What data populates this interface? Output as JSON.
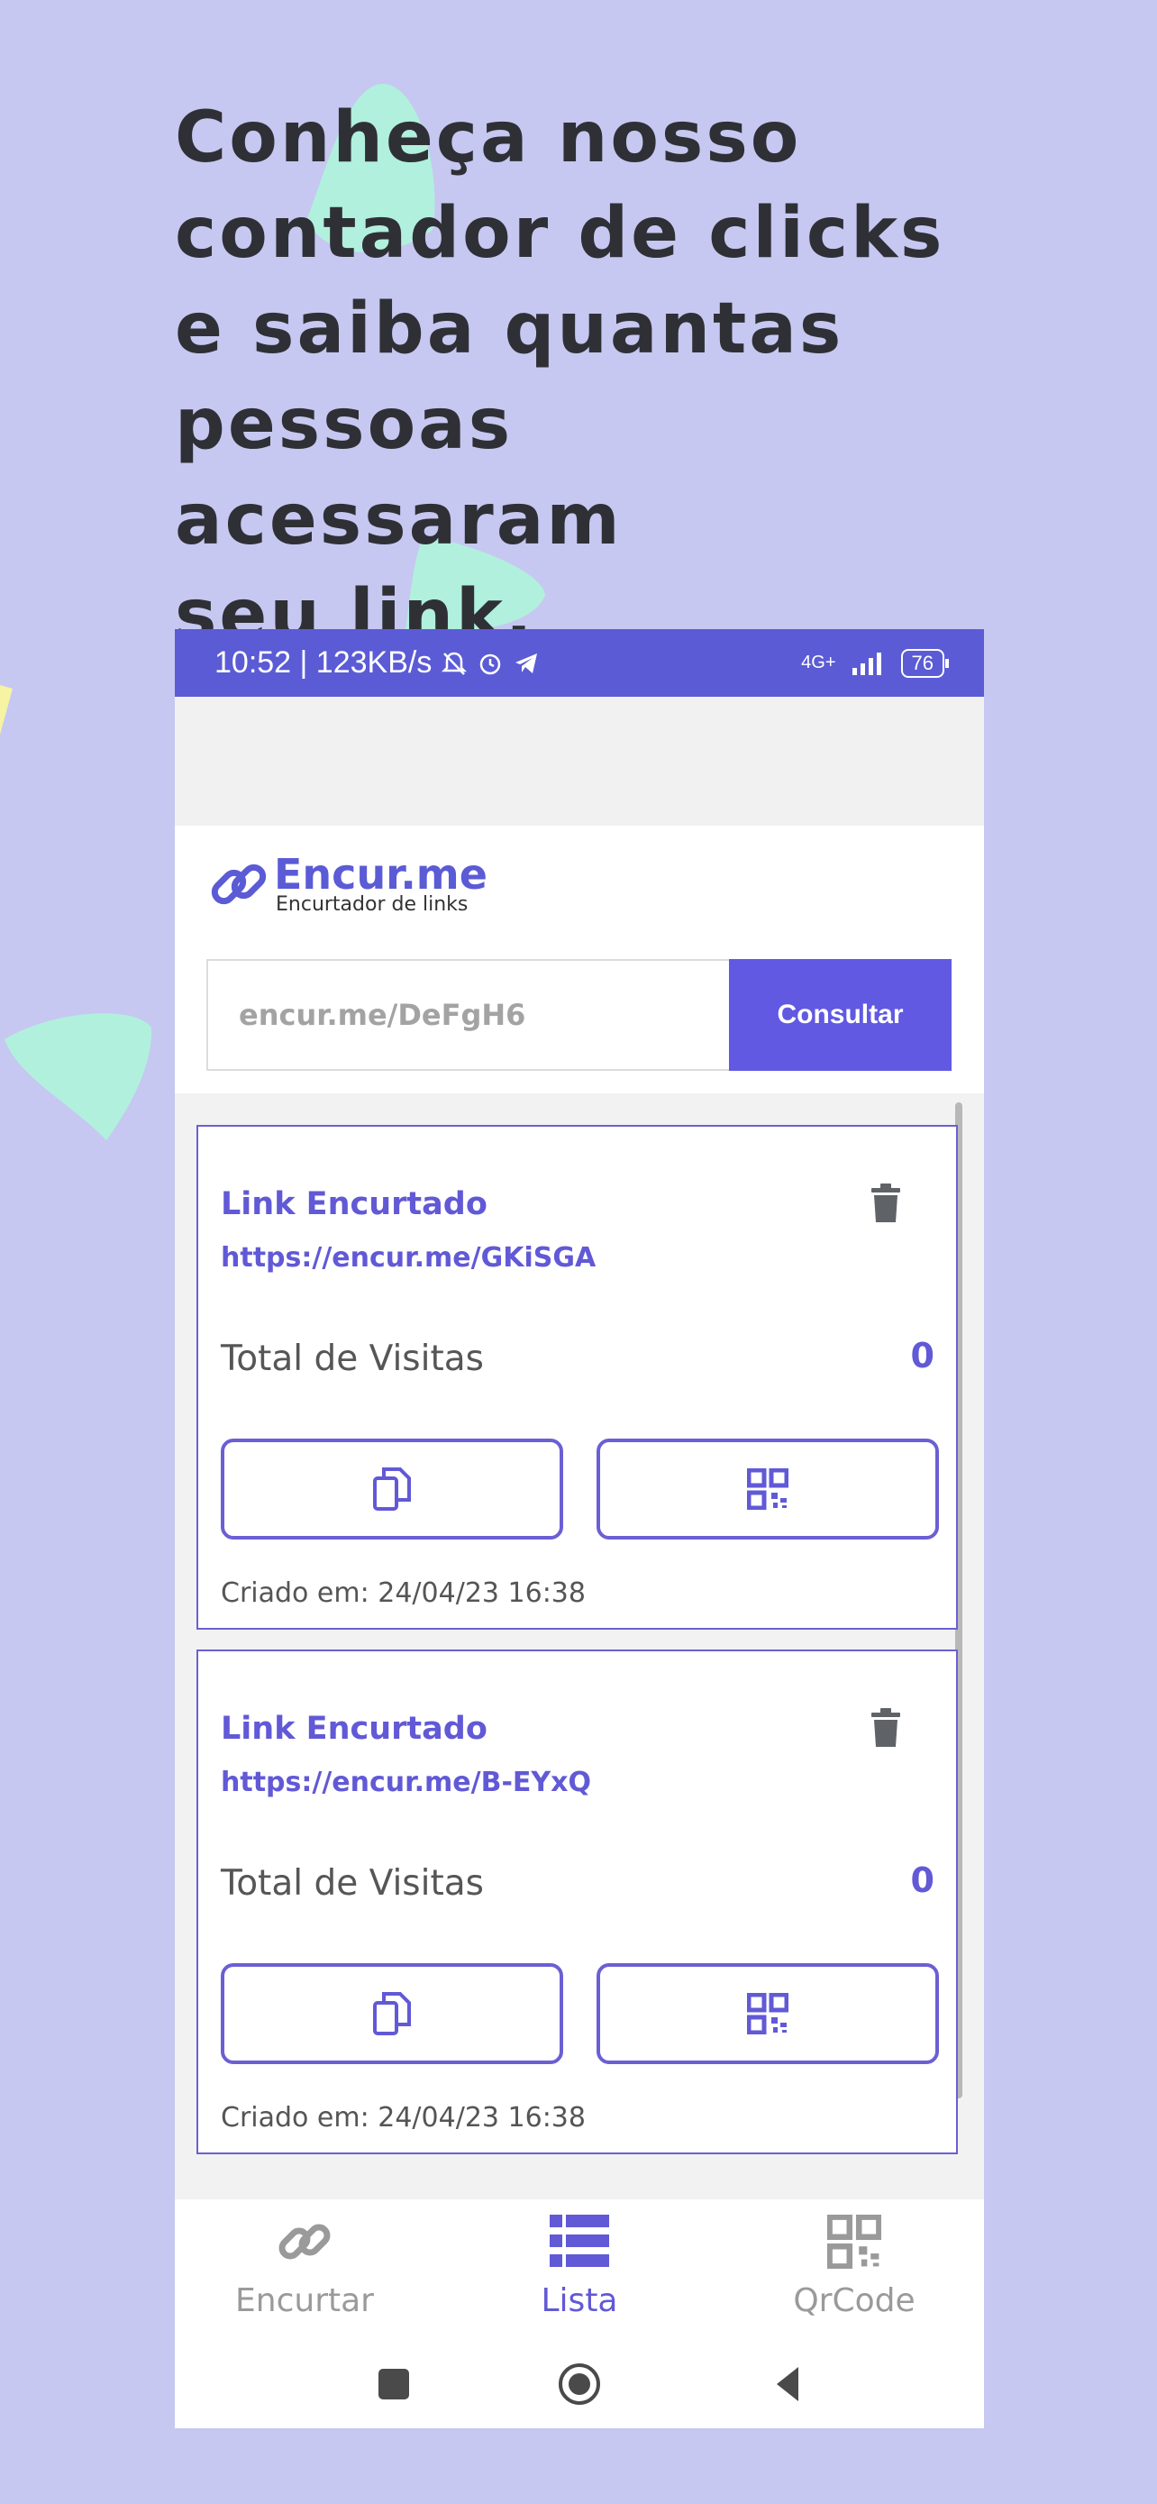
{
  "headline": {
    "line1": "Conheça nosso",
    "line2": "contador de clicks",
    "line3": "e saiba quantas",
    "line4": "pessoas acessaram",
    "line5": "seu link."
  },
  "colors": {
    "background": "#c6c8f1",
    "accent": "#6159e2",
    "status_bar": "#5b5bd6",
    "blob_mint": "#b1f0dd",
    "blob_yellow": "#f6f3a3"
  },
  "status_bar": {
    "time_speed": "10:52 | 123KB/s",
    "network": "4G+",
    "battery": "76"
  },
  "app": {
    "logo_title": "Encur.me",
    "logo_subtitle": "Encurtador de links",
    "search": {
      "placeholder": "encur.me/DeFgH6",
      "button_label": "Consultar"
    }
  },
  "links": [
    {
      "title": "Link Encurtado",
      "url": "https://encur.me/GKiSGA",
      "visits_label": "Total de Visitas",
      "visits": "0",
      "created": "Criado em: 24/04/23 16:38"
    },
    {
      "title": "Link Encurtado",
      "url": "https://encur.me/B-EYxQ",
      "visits_label": "Total de Visitas",
      "visits": "0",
      "created": "Criado em: 24/04/23 16:38"
    }
  ],
  "bottom_nav": {
    "items": [
      {
        "label": "Encurtar",
        "icon": "link-icon",
        "active": false
      },
      {
        "label": "Lista",
        "icon": "list-icon",
        "active": true
      },
      {
        "label": "QrCode",
        "icon": "qrcode-icon",
        "active": false
      }
    ]
  }
}
